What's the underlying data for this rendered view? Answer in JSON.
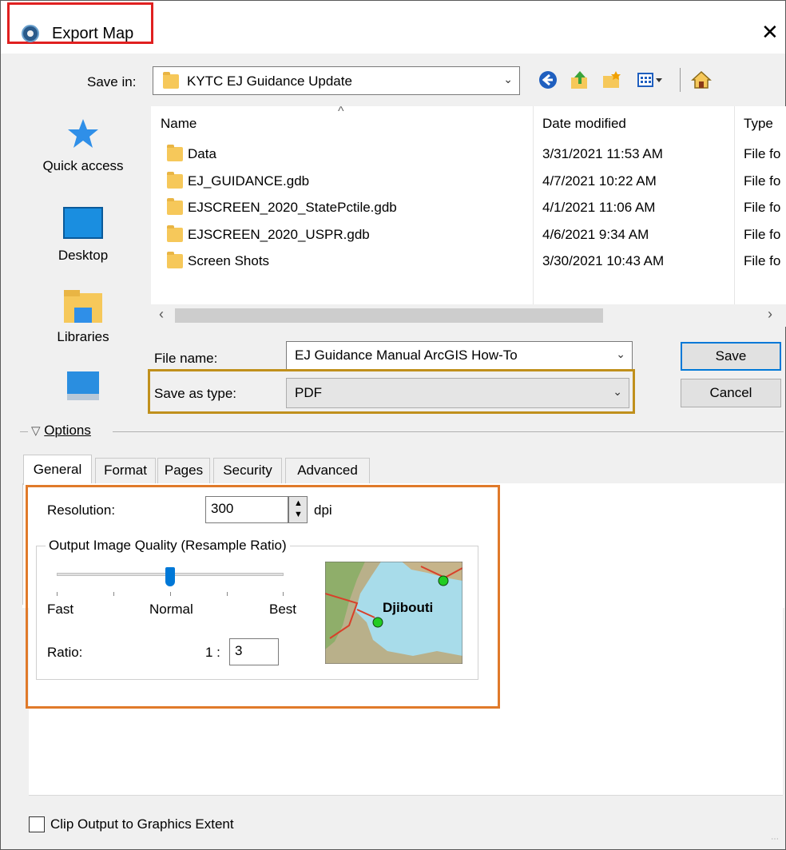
{
  "window": {
    "title": "Export Map",
    "close_glyph": "✕"
  },
  "save_in": {
    "label": "Save in:",
    "folder": "KYTC EJ Guidance Update"
  },
  "toolbar_icons": [
    "back-icon",
    "up-folder-icon",
    "new-folder-icon",
    "view-menu-icon",
    "home-icon"
  ],
  "places": [
    {
      "label": "Quick access",
      "icon": "star-icon"
    },
    {
      "label": "Desktop",
      "icon": "desktop-icon"
    },
    {
      "label": "Libraries",
      "icon": "libraries-icon"
    },
    {
      "label": "",
      "icon": "this-pc-icon"
    }
  ],
  "file_list": {
    "columns": [
      "Name",
      "Date modified",
      "Type"
    ],
    "rows": [
      {
        "name": "Data",
        "date": "3/31/2021 11:53 AM",
        "type": "File fo"
      },
      {
        "name": "EJ_GUIDANCE.gdb",
        "date": "4/7/2021 10:22 AM",
        "type": "File fo"
      },
      {
        "name": "EJSCREEN_2020_StatePctile.gdb",
        "date": "4/1/2021 11:06 AM",
        "type": "File fo"
      },
      {
        "name": "EJSCREEN_2020_USPR.gdb",
        "date": "4/6/2021 9:34 AM",
        "type": "File fo"
      },
      {
        "name": "Screen Shots",
        "date": "3/30/2021 10:43 AM",
        "type": "File fo"
      }
    ]
  },
  "file_name": {
    "label": "File name:",
    "value": "EJ Guidance Manual ArcGIS How-To"
  },
  "save_as_type": {
    "label": "Save as type:",
    "value": "PDF"
  },
  "buttons": {
    "save": "Save",
    "cancel": "Cancel"
  },
  "options": {
    "label": "Options"
  },
  "tabs": [
    "General",
    "Format",
    "Pages",
    "Security",
    "Advanced"
  ],
  "general": {
    "resolution_label": "Resolution:",
    "resolution_value": "300",
    "resolution_unit": "dpi",
    "quality_group": "Output Image Quality (Resample Ratio)",
    "slider_labels": {
      "fast": "Fast",
      "normal": "Normal",
      "best": "Best"
    },
    "slider_level": 0.5,
    "ratio_label": "Ratio:",
    "ratio_prefix": "1 :",
    "ratio_value": "3",
    "preview_label": "Djibouti"
  },
  "clip_output": {
    "label": "Clip Output to Graphics Extent",
    "checked": false
  },
  "colors": {
    "title_highlight": "#e02020",
    "type_highlight": "#c0901c",
    "resolution_highlight": "#e07a2a",
    "default_button": "#0078d7"
  }
}
